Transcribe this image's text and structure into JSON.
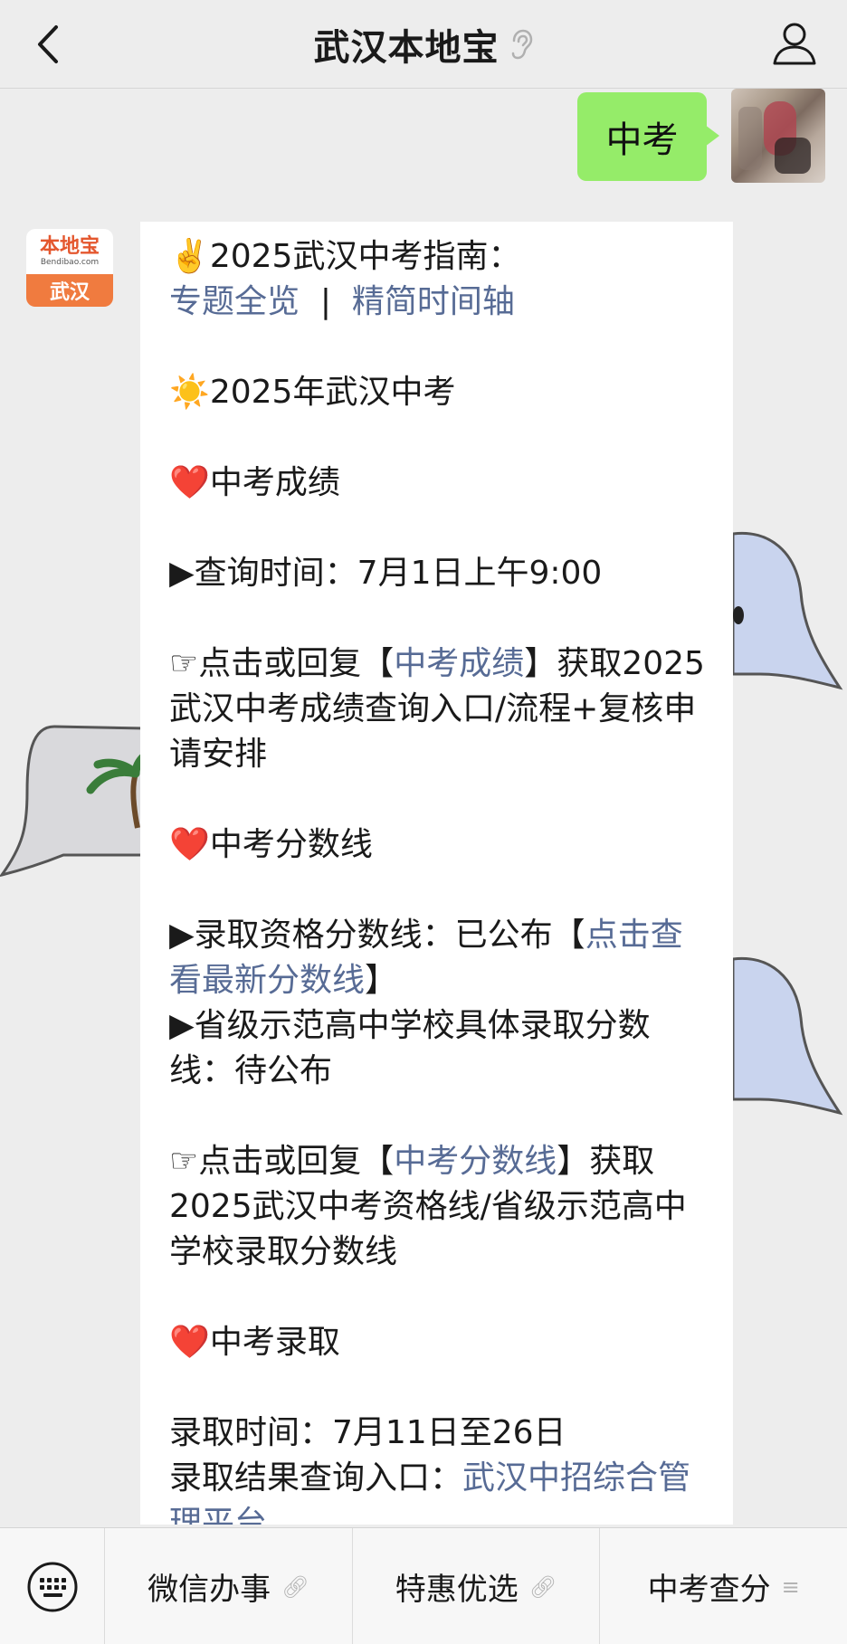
{
  "header": {
    "title": "武汉本地宝",
    "back_icon": "chevron-left-icon",
    "title_icon": "ear-icon",
    "profile_icon": "person-icon"
  },
  "chat": {
    "user_message": "中考",
    "bot_avatar": {
      "brand": "本地宝",
      "domain": "Bendibao.com",
      "city": "武汉"
    },
    "reply": {
      "guide_title": "✌️2025武汉中考指南：",
      "guide_link_1": "专题全览",
      "guide_separator": "  |  ",
      "guide_link_2": "精简时间轴",
      "section_title": "☀️2025年武汉中考",
      "score": {
        "heading": "中考成绩",
        "query_time": "▶查询时间：7月1日上午9:00",
        "tip_prefix": "☞点击或回复【",
        "tip_link": "中考成绩",
        "tip_suffix": "】获取2025武汉中考成绩查询入口/流程+复核申请安排"
      },
      "cutoff": {
        "heading": "中考分数线",
        "line1_prefix": "▶录取资格分数线：已公布【",
        "line1_link": "点击查看最新分数线",
        "line1_suffix": "】",
        "line2": "▶省级示范高中学校具体录取分数线：待公布",
        "tip_prefix": "☞点击或回复【",
        "tip_link": "中考分数线",
        "tip_suffix": "】获取2025武汉中考资格线/省级示范高中学校录取分数线"
      },
      "admission": {
        "heading": "中考录取",
        "time": "录取时间：7月11日至26日",
        "result_prefix": "录取结果查询入口：",
        "result_link": "武汉中招综合管理平台"
      }
    }
  },
  "menu": {
    "keyboard_icon": "keyboard-icon",
    "items": [
      {
        "label": "微信办事",
        "icon": "link-icon"
      },
      {
        "label": "特惠优选",
        "icon": "link-icon"
      },
      {
        "label": "中考查分",
        "icon": "list-icon"
      }
    ]
  },
  "colors": {
    "user_bubble": "#95ec69",
    "link": "#576b95",
    "background": "#ededed",
    "heart": "#e0262c"
  }
}
